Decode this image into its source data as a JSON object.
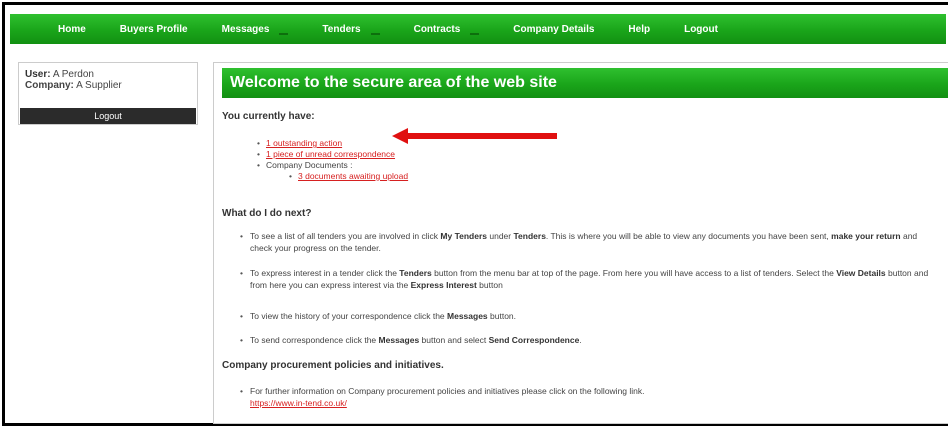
{
  "nav": {
    "items": [
      {
        "label": "Home"
      },
      {
        "label": "Buyers Profile"
      },
      {
        "label": "Messages",
        "dropdown": true
      },
      {
        "label": "Tenders",
        "dropdown": true
      },
      {
        "label": "Contracts",
        "dropdown": true
      },
      {
        "label": "Company Details"
      },
      {
        "label": "Help"
      },
      {
        "label": "Logout"
      }
    ]
  },
  "sidebar": {
    "user_label": "User:",
    "user_value": "A Perdon",
    "company_label": "Company:",
    "company_value": "A Supplier",
    "logout_label": "Logout"
  },
  "main": {
    "banner": "Welcome to the secure area of the web site",
    "have_heading": "You currently have:",
    "action_link": "1 outstanding action",
    "correspondence_link": "1 piece of unread correspondence",
    "documents_label": "Company Documents :",
    "documents_link": "3 documents awaiting upload",
    "next_heading": "What do I do next?",
    "next_items": [
      {
        "parts": [
          "To see a list of all tenders you are involved in click ",
          "My Tenders",
          " under ",
          "Tenders",
          ". This is where you will be able to view any documents you have been sent, ",
          "make your return",
          " and check your progress on the tender."
        ]
      },
      {
        "parts": [
          "To express interest in a tender click the ",
          "Tenders",
          " button from the menu bar at top of the page. From here you will have access to a list of tenders. Select the ",
          "View Details",
          " button and from here you can express interest via the ",
          "Express Interest",
          " button"
        ]
      },
      {
        "parts": [
          "To view the history of your correspondence click the ",
          "Messages",
          " button."
        ]
      },
      {
        "parts": [
          "To send correspondence click the ",
          "Messages",
          " button and select ",
          "Send Correspondence",
          "."
        ]
      }
    ],
    "policy_heading": "Company procurement policies and initiatives.",
    "policy_text": "For further information on Company procurement policies and initiatives please click on the following link.",
    "policy_link": "https://www.in-tend.co.uk/"
  },
  "colors": {
    "green": "#1aa51a",
    "link_red": "#d62020",
    "arrow_red": "#e01010"
  }
}
